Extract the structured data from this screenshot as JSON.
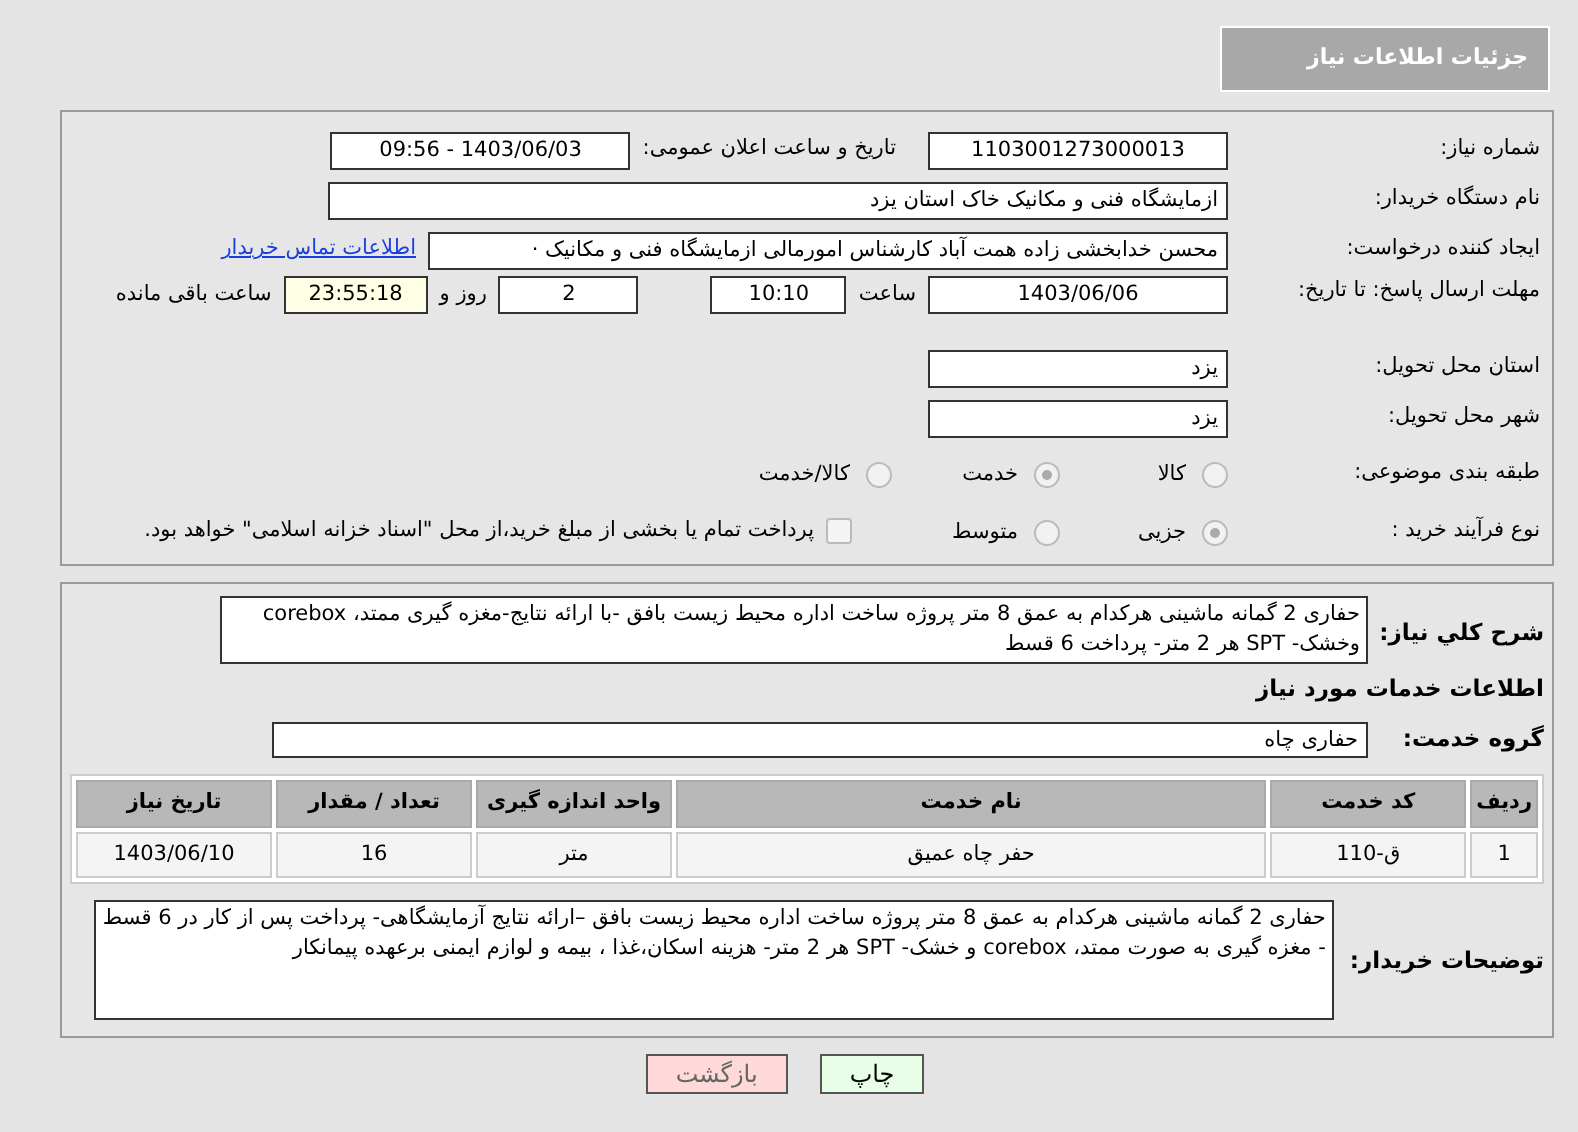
{
  "header": {
    "title": "جزئیات اطلاعات نیاز"
  },
  "need_number": {
    "label": "شماره نیاز:",
    "value": "1103001273000013"
  },
  "announce": {
    "label": "تاریخ و ساعت اعلان عمومی:",
    "value": "1403/06/03 - 09:56"
  },
  "buyer_org": {
    "label": "نام دستگاه خریدار:",
    "value": "ازمایشگاه فنی و مکانیک خاک استان یزد"
  },
  "requester": {
    "label": "ایجاد کننده درخواست:",
    "value": "محسن خدابخشی زاده همت آباد کارشناس امورمالی ازمایشگاه فنی و مکانیک ·",
    "link": "اطلاعات تماس خریدار"
  },
  "deadline": {
    "label": "مهلت ارسال پاسخ: تا تاریخ:",
    "date": "1403/06/06",
    "time_label": "ساعت",
    "time": "10:10",
    "days": "2",
    "days_label": "روز و",
    "remaining": "23:55:18",
    "remaining_label": "ساعت باقی مانده"
  },
  "province": {
    "label": "استان محل تحویل:",
    "value": "یزد"
  },
  "city": {
    "label": "شهر محل تحویل:",
    "value": "یزد"
  },
  "category": {
    "label": "طبقه بندی موضوعی:",
    "options": [
      {
        "label": "کالا",
        "selected": false
      },
      {
        "label": "خدمت",
        "selected": true
      },
      {
        "label": "کالا/خدمت",
        "selected": false
      }
    ]
  },
  "process": {
    "label": "نوع فرآیند خرید :",
    "options": [
      {
        "label": "جزیی",
        "selected": true
      },
      {
        "label": "متوسط",
        "selected": false
      }
    ],
    "treasury": {
      "checked": false,
      "text": "پرداخت تمام یا بخشی از مبلغ خرید،از محل \"اسناد خزانه اسلامی\" خواهد بود."
    }
  },
  "description": {
    "label": "شرح کلي نياز:",
    "value": "حفاری 2 گمانه ماشینی هرکدام به عمق 8 متر پروژه ساخت اداره محیط زیست بافق -با ارائه نتایج-مغزه گیری ممتد، corebox وخشک- SPT هر 2 متر- پرداخت 6 قسط"
  },
  "services_heading": "اطلاعات خدمات مورد نیاز",
  "service_group": {
    "label": "گروه خدمت:",
    "value": "حفاری چاه"
  },
  "table": {
    "columns": [
      "ردیف",
      "کد خدمت",
      "نام خدمت",
      "واحد اندازه گیری",
      "تعداد / مقدار",
      "تاریخ نیاز"
    ],
    "rows": [
      [
        "1",
        "ق-110",
        "حفر چاه عمیق",
        "متر",
        "16",
        "1403/06/10"
      ]
    ]
  },
  "buyer_notes": {
    "label": "توضیحات خریدار:",
    "value": "حفاری 2 گمانه ماشینی هرکدام به عمق 8 متر پروژه ساخت اداره محیط زیست بافق –ارائه نتایج آزمایشگاهی- پرداخت پس از کار در 6 قسط - مغزه گیری به صورت ممتد، corebox و خشک- SPT هر 2 متر- هزینه اسکان،غذا ، بیمه و لوازم ایمنی برعهده پیمانکار"
  },
  "buttons": [
    {
      "label": "چاپ",
      "kind": "print"
    },
    {
      "label": "بازگشت",
      "kind": "back"
    }
  ]
}
